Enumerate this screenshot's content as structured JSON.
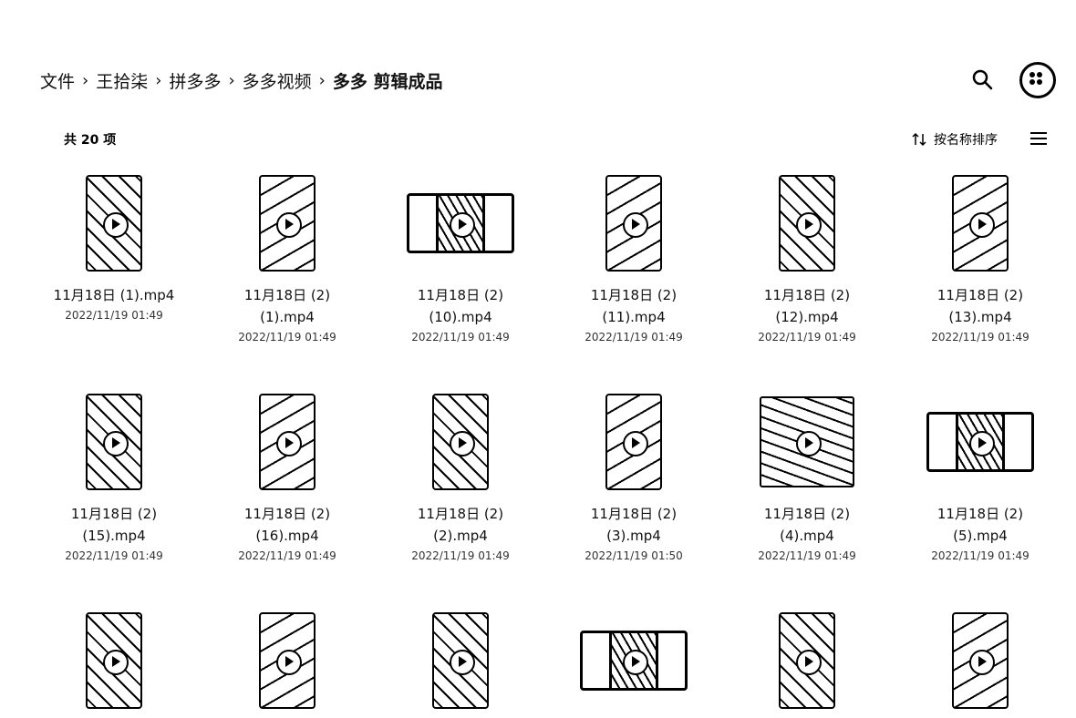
{
  "breadcrumb": [
    "文件",
    "王拾柒",
    "拼多多",
    "多多视频",
    "多多 剪辑成品"
  ],
  "breadcrumb_separator": "›",
  "item_count": "共 20 项",
  "sort_label": "按名称排序",
  "files": [
    {
      "name": "11月18日 (1).mp4",
      "date": "2022/11/19 01:49",
      "thumb": "portrait"
    },
    {
      "name": "11月18日 (2)\n(1).mp4",
      "date": "2022/11/19 01:49",
      "thumb": "portrait"
    },
    {
      "name": "11月18日 (2)\n(10).mp4",
      "date": "2022/11/19 01:49",
      "thumb": "landscape"
    },
    {
      "name": "11月18日 (2)\n(11).mp4",
      "date": "2022/11/19 01:49",
      "thumb": "portrait"
    },
    {
      "name": "11月18日 (2)\n(12).mp4",
      "date": "2022/11/19 01:49",
      "thumb": "portrait"
    },
    {
      "name": "11月18日 (2)\n(13).mp4",
      "date": "2022/11/19 01:49",
      "thumb": "portrait"
    },
    {
      "name": "11月18日 (2)\n(15).mp4",
      "date": "2022/11/19 01:49",
      "thumb": "portrait"
    },
    {
      "name": "11月18日 (2)\n(16).mp4",
      "date": "2022/11/19 01:49",
      "thumb": "portrait"
    },
    {
      "name": "11月18日 (2)\n(2).mp4",
      "date": "2022/11/19 01:49",
      "thumb": "portrait"
    },
    {
      "name": "11月18日 (2)\n(3).mp4",
      "date": "2022/11/19 01:50",
      "thumb": "portrait"
    },
    {
      "name": "11月18日 (2)\n(4).mp4",
      "date": "2022/11/19 01:49",
      "thumb": "wide"
    },
    {
      "name": "11月18日 (2)\n(5).mp4",
      "date": "2022/11/19 01:49",
      "thumb": "landscape"
    },
    {
      "name": "",
      "date": "",
      "thumb": "portrait"
    },
    {
      "name": "",
      "date": "",
      "thumb": "portrait"
    },
    {
      "name": "",
      "date": "",
      "thumb": "portrait"
    },
    {
      "name": "",
      "date": "",
      "thumb": "landscape"
    },
    {
      "name": "",
      "date": "",
      "thumb": "portrait"
    },
    {
      "name": "",
      "date": "",
      "thumb": "portrait"
    }
  ],
  "icons": {
    "search": "search-icon",
    "menu": "more-menu-icon",
    "sort": "sort-arrows-icon",
    "view": "list-view-icon"
  }
}
